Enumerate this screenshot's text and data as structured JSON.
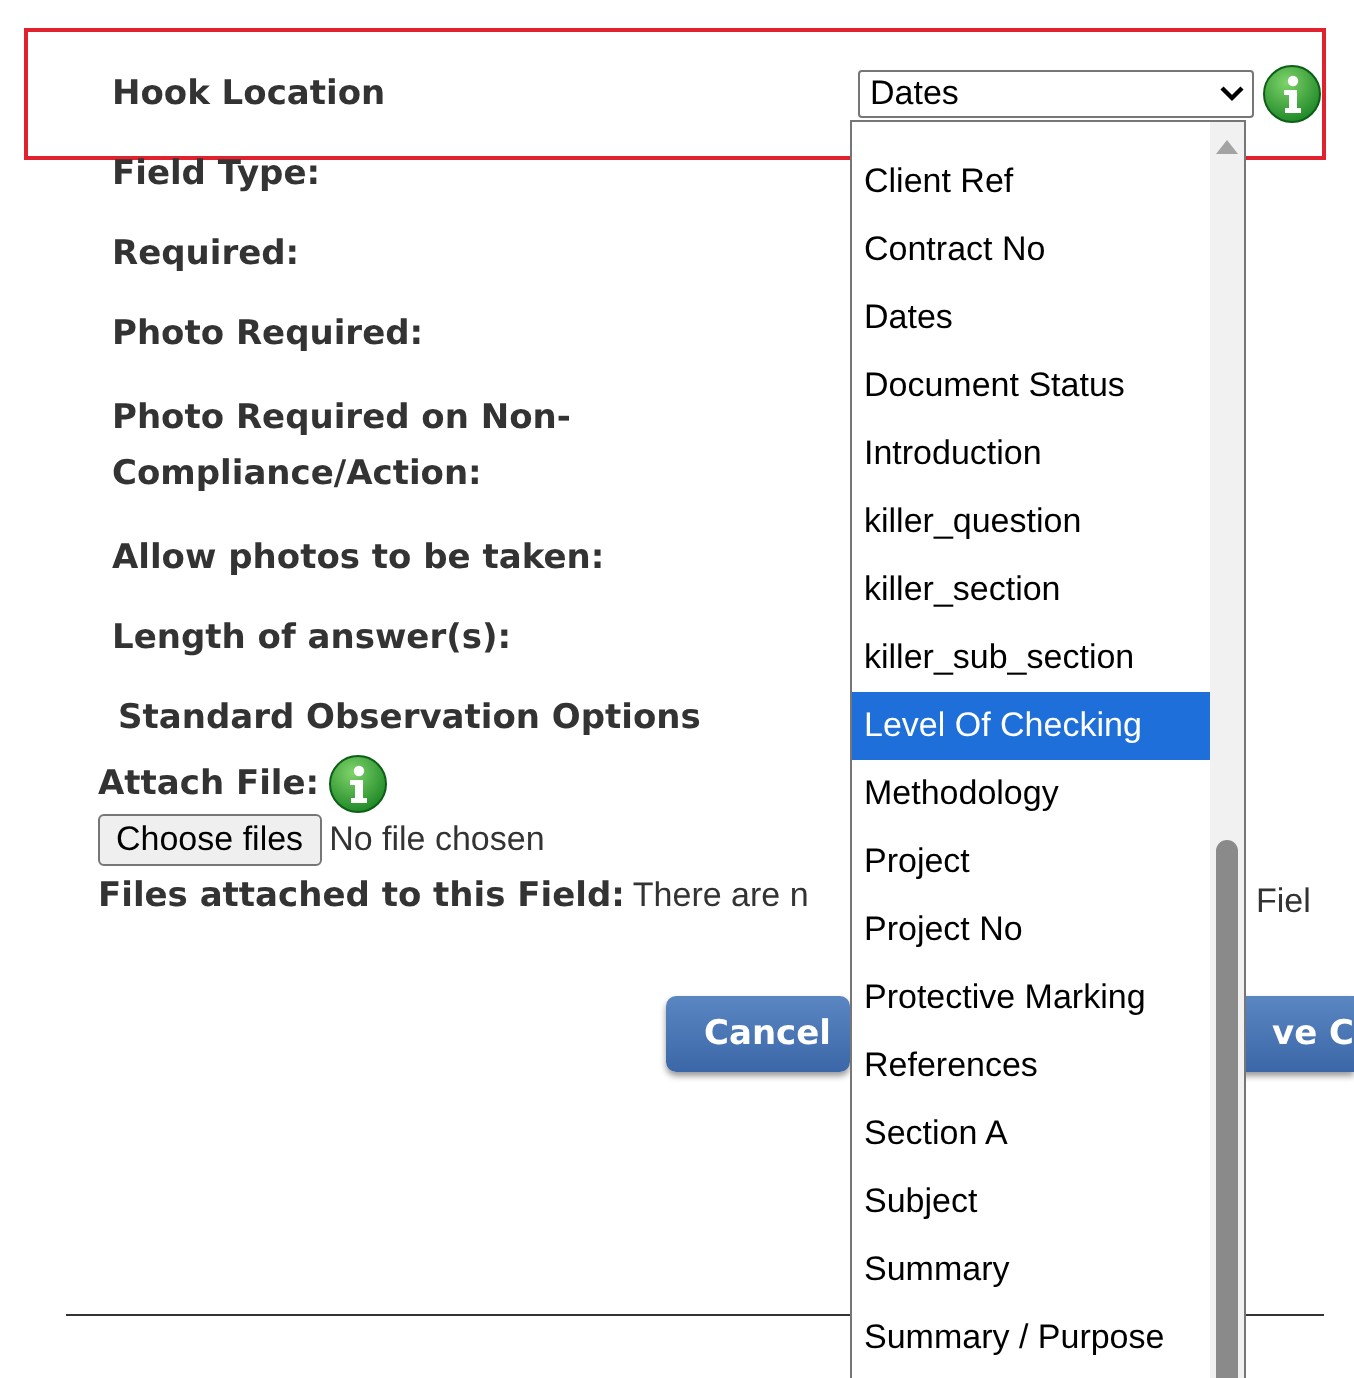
{
  "header": {
    "label": "Hook Location",
    "select_value": "Dates"
  },
  "fields": [
    {
      "label": "Field Type:"
    },
    {
      "label": "Required:"
    },
    {
      "label": "Photo Required:"
    },
    {
      "label": "Photo Required on Non-Compliance/Action:"
    },
    {
      "label": "Allow photos to be taken:"
    },
    {
      "label": "Length of answer(s):"
    },
    {
      "label": "Standard Observation Options",
      "kind": "heading"
    }
  ],
  "attach": {
    "label": "Attach File:",
    "button": "Choose files",
    "status": "No file chosen"
  },
  "attached": {
    "label": "Files attached to this Field:",
    "value": "There are n",
    "value_tail": "Fiel"
  },
  "buttons": [
    {
      "label": "Cancel",
      "kind": "cancel"
    },
    {
      "label": "ve C",
      "kind": "save"
    }
  ],
  "dropdown": {
    "items": [
      {
        "label": "Client Ref",
        "selected": false
      },
      {
        "label": "Contract No",
        "selected": false
      },
      {
        "label": "Dates",
        "selected": false
      },
      {
        "label": "Document Status",
        "selected": false
      },
      {
        "label": "Introduction",
        "selected": false
      },
      {
        "label": "killer_question",
        "selected": false
      },
      {
        "label": "killer_section",
        "selected": false
      },
      {
        "label": "killer_sub_section",
        "selected": false
      },
      {
        "label": "Level Of Checking",
        "selected": true
      },
      {
        "label": "Methodology",
        "selected": false
      },
      {
        "label": "Project",
        "selected": false
      },
      {
        "label": "Project No",
        "selected": false
      },
      {
        "label": "Protective Marking",
        "selected": false
      },
      {
        "label": "References",
        "selected": false
      },
      {
        "label": "Section A",
        "selected": false
      },
      {
        "label": "Subject",
        "selected": false
      },
      {
        "label": "Summary",
        "selected": false
      },
      {
        "label": "Summary / Purpose",
        "selected": false
      }
    ]
  }
}
